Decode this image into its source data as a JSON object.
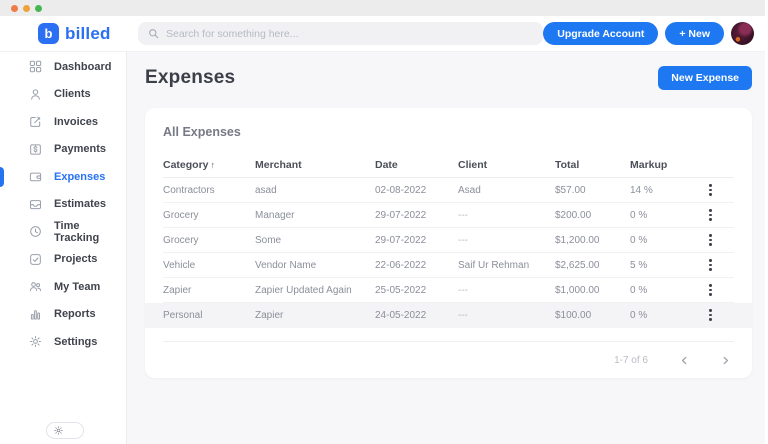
{
  "header": {
    "logo_mark": "b",
    "logo_text": "billed",
    "search_placeholder": "Search for something here...",
    "upgrade_label": "Upgrade Account",
    "new_label": "+ New"
  },
  "sidebar": {
    "items": [
      {
        "label": "Dashboard",
        "icon": "dashboard-icon",
        "active": false
      },
      {
        "label": "Clients",
        "icon": "clients-icon",
        "active": false
      },
      {
        "label": "Invoices",
        "icon": "invoices-icon",
        "active": false
      },
      {
        "label": "Payments",
        "icon": "payments-icon",
        "active": false
      },
      {
        "label": "Expenses",
        "icon": "expenses-icon",
        "active": true
      },
      {
        "label": "Estimates",
        "icon": "estimates-icon",
        "active": false
      },
      {
        "label": "Time Tracking",
        "icon": "time-tracking-icon",
        "active": false
      },
      {
        "label": "Projects",
        "icon": "projects-icon",
        "active": false
      },
      {
        "label": "My Team",
        "icon": "my-team-icon",
        "active": false
      },
      {
        "label": "Reports",
        "icon": "reports-icon",
        "active": false
      },
      {
        "label": "Settings",
        "icon": "settings-icon",
        "active": false
      }
    ]
  },
  "page": {
    "title": "Expenses",
    "new_expense_label": "New Expense"
  },
  "table": {
    "card_title": "All Expenses",
    "columns": [
      "Category",
      "Merchant",
      "Date",
      "Client",
      "Total",
      "Markup"
    ],
    "sort_column": "Category",
    "sort_indicator": "↑",
    "rows": [
      {
        "category": "Contractors",
        "merchant": "asad",
        "date": "02-08-2022",
        "client": "Asad",
        "total": "$57.00",
        "markup": "14 %"
      },
      {
        "category": "Grocery",
        "merchant": "Manager",
        "date": "29-07-2022",
        "client": "---",
        "total": "$200.00",
        "markup": "0 %"
      },
      {
        "category": "Grocery",
        "merchant": "Some",
        "date": "29-07-2022",
        "client": "---",
        "total": "$1,200.00",
        "markup": "0 %"
      },
      {
        "category": "Vehicle",
        "merchant": "Vendor Name",
        "date": "22-06-2022",
        "client": "Saif Ur Rehman",
        "total": "$2,625.00",
        "markup": "5 %"
      },
      {
        "category": "Zapier",
        "merchant": "Zapier Updated Again",
        "date": "25-05-2022",
        "client": "---",
        "total": "$1,000.00",
        "markup": "0 %"
      },
      {
        "category": "Personal",
        "merchant": "Zapier",
        "date": "24-05-2022",
        "client": "---",
        "total": "$100.00",
        "markup": "0 %"
      }
    ],
    "pagination": {
      "range_label": "1-7 of 6",
      "prev_icon": "chevron-left",
      "next_icon": "chevron-right"
    }
  },
  "colors": {
    "accent_blue": "#1d78f2",
    "logo_blue": "#2b6ff2",
    "active_item_blue": "#2673f2",
    "main_bg": "#f7f7f9",
    "row_highlight": "#f4f4f6"
  }
}
